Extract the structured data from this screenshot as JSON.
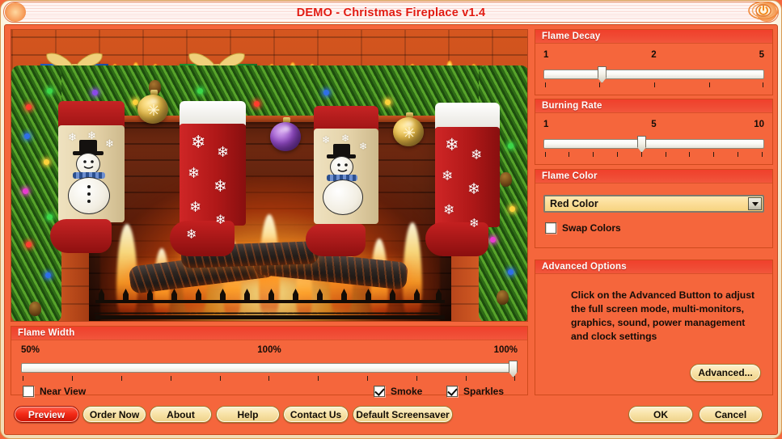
{
  "window": {
    "title": "DEMO - Christmas Fireplace v1.4",
    "power_icon": "power-button-icon",
    "frame_color": "#f5663c",
    "accent_color": "#f0402b",
    "button_face": "#f8e3a8"
  },
  "preview": {
    "name": "christmas-fireplace-preview",
    "description": "Animated Christmas fireplace scene with burning logs, stockings, garland, candles, gift boxes and ornaments"
  },
  "flame_decay": {
    "title": "Flame Decay",
    "min_label": "1",
    "mid_label": "2",
    "max_label": "5",
    "min": 1,
    "max": 5,
    "value": 2,
    "ticks": 5
  },
  "burning_rate": {
    "title": "Burning Rate",
    "min_label": "1",
    "mid_label": "5",
    "max_label": "10",
    "min": 1,
    "max": 10,
    "value": 5,
    "ticks": 10
  },
  "flame_color": {
    "title": "Flame Color",
    "selected": "Red Color",
    "dropdown_icon": "chevron-down-icon",
    "swap_colors_label": "Swap Colors",
    "swap_colors_checked": false
  },
  "advanced_options": {
    "title": "Advanced Options",
    "help_line_1": "Click on the Advanced Button to adjust",
    "help_line_2": "the full screen mode, multi-monitors,",
    "help_line_3": "graphics, sound, power management",
    "help_line_4": "and clock settings",
    "button_label": "Advanced..."
  },
  "flame_width": {
    "title": "Flame Width",
    "min_label": "50%",
    "value_label": "100%",
    "max_label": "100%",
    "min": 50,
    "max": 100,
    "value": 100,
    "ticks": 11,
    "near_view_label": "Near View",
    "near_view_checked": false,
    "smoke_label": "Smoke",
    "smoke_checked": true,
    "sparkles_label": "Sparkles",
    "sparkles_checked": true
  },
  "buttons": {
    "preview": "Preview",
    "order_now": "Order Now",
    "about": "About",
    "help": "Help",
    "contact_us": "Contact Us",
    "default_screensaver": "Default Screensaver",
    "ok": "OK",
    "cancel": "Cancel"
  }
}
